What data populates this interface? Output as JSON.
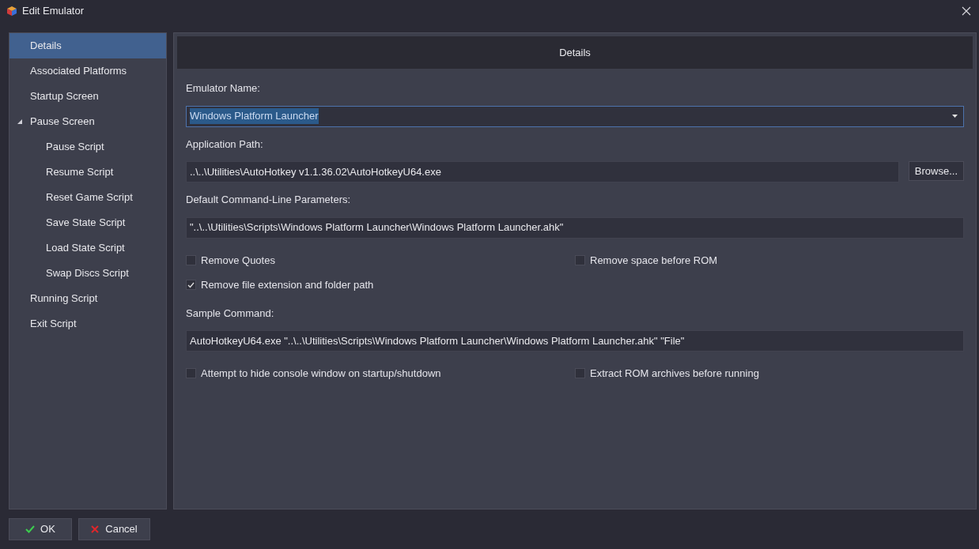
{
  "window": {
    "title": "Edit Emulator"
  },
  "sidebar": {
    "items": [
      {
        "label": "Details",
        "selected": true
      },
      {
        "label": "Associated Platforms",
        "selected": false
      },
      {
        "label": "Startup Screen",
        "selected": false
      },
      {
        "label": "Pause Screen",
        "selected": false,
        "expanded": true,
        "children": [
          {
            "label": "Pause Script",
            "selected": false
          },
          {
            "label": "Resume Script",
            "selected": false
          },
          {
            "label": "Reset Game Script",
            "selected": false
          },
          {
            "label": "Save State Script",
            "selected": false
          },
          {
            "label": "Load State Script",
            "selected": false
          },
          {
            "label": "Swap Discs Script",
            "selected": false
          }
        ]
      },
      {
        "label": "Running Script",
        "selected": false
      },
      {
        "label": "Exit Script",
        "selected": false
      }
    ]
  },
  "panel": {
    "title": "Details",
    "emulator_name": {
      "label": "Emulator Name:",
      "value": "Windows Platform Launcher"
    },
    "application_path": {
      "label": "Application Path:",
      "value": "..\\..\\Utilities\\AutoHotkey v1.1.36.02\\AutoHotkeyU64.exe",
      "button": "Browse..."
    },
    "parameters": {
      "label": "Default Command-Line Parameters:",
      "value": "\"..\\..\\Utilities\\Scripts\\Windows Platform Launcher\\Windows Platform Launcher.ahk\""
    },
    "options_1": [
      [
        {
          "label": "Remove Quotes",
          "checked": false
        },
        {
          "label": "Remove space before ROM",
          "checked": false
        }
      ],
      [
        {
          "label": "Remove file extension and folder path",
          "checked": true
        }
      ]
    ],
    "sample_command": {
      "label": "Sample Command:",
      "value": "AutoHotkeyU64.exe \"..\\..\\Utilities\\Scripts\\Windows Platform Launcher\\Windows Platform Launcher.ahk\" \"File\""
    },
    "options_2": [
      [
        {
          "label": "Attempt to hide console window on startup/shutdown",
          "checked": false
        },
        {
          "label": "Extract ROM archives before running",
          "checked": false
        }
      ]
    ]
  },
  "buttons": {
    "ok": "OK",
    "cancel": "Cancel"
  }
}
